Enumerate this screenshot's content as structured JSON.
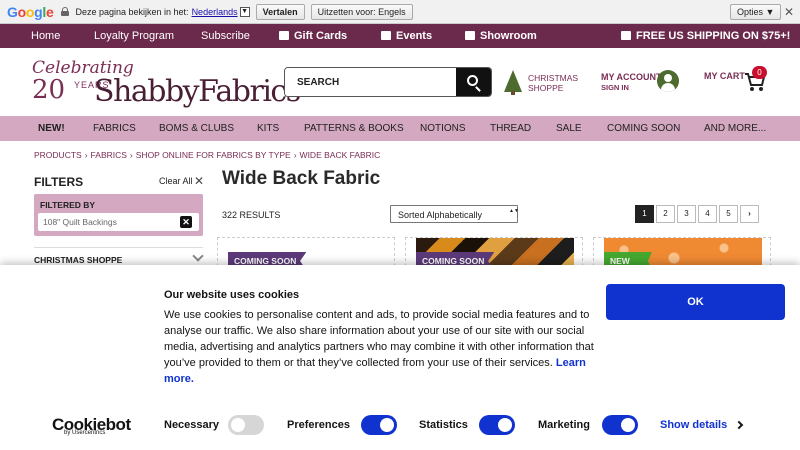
{
  "translate_bar": {
    "logo": "Google",
    "prompt": "Deze pagina bekijken in het:",
    "language": "Nederlands",
    "translate_btn": "Vertalen",
    "disable_btn": "Uitzetten voor: Engels",
    "options_btn": "Opties ▼",
    "close": "✕"
  },
  "top_nav": {
    "home": "Home",
    "loyalty": "Loyalty Program",
    "subscribe": "Subscribe",
    "gift_cards": "Gift Cards",
    "events": "Events",
    "showroom": "Showroom",
    "shipping": "FREE US SHIPPING ON $75+!"
  },
  "header": {
    "logo_celebrating": "Celebrating",
    "logo_20": "20",
    "logo_years": "YEARS",
    "logo_brand": "ShabbyFabrics",
    "search_placeholder": "SEARCH",
    "christmas": "CHRISTMAS SHOPPE",
    "account_title": "MY ACCOUNT",
    "account_sub": "SIGN IN",
    "cart_title": "MY CART",
    "cart_count": "0"
  },
  "category_nav": [
    "NEW!",
    "FABRICS",
    "BOMS & CLUBS",
    "KITS",
    "PATTERNS & BOOKS",
    "NOTIONS",
    "THREAD",
    "SALE",
    "COMING SOON",
    "AND MORE..."
  ],
  "breadcrumbs": [
    "PRODUCTS",
    "FABRICS",
    "SHOP ONLINE FOR FABRICS BY TYPE",
    "WIDE BACK FABRIC"
  ],
  "breadcrumb_sep": "›",
  "filters": {
    "title": "FILTERS",
    "clear_all": "Clear All",
    "clear_x": "✕",
    "filtered_by": "FILTERED BY",
    "chip": "108\" Quilt Backings",
    "chip_x": "✕",
    "section": "CHRISTMAS SHOPPE"
  },
  "main": {
    "title": "Wide Back Fabric",
    "results": "322 RESULTS",
    "sort": "Sorted Alphabetically",
    "sort_arrows": "▲▼",
    "pages": [
      "1",
      "2",
      "3",
      "4",
      "5"
    ],
    "next": "›",
    "cards": [
      {
        "ribbon": "COMING SOON"
      },
      {
        "ribbon": "COMING SOON"
      },
      {
        "ribbon": "NEW"
      }
    ]
  },
  "cookie": {
    "title": "Our website uses cookies",
    "body": "We use cookies to personalise content and ads, to provide social media features and to analyse our traffic. We also share information about your use of our site with our social media, advertising and analytics partners who may combine it with other information that you’ve provided to them or that they’ve collected from your use of their services.",
    "learn_more": "Learn more.",
    "ok": "OK",
    "logo": "Cookiebot",
    "logo_sub": "by Usercentrics",
    "toggles": [
      {
        "label": "Necessary",
        "on": false
      },
      {
        "label": "Preferences",
        "on": true
      },
      {
        "label": "Statistics",
        "on": true
      },
      {
        "label": "Marketing",
        "on": true
      }
    ],
    "show_details": "Show details"
  },
  "colors": {
    "brand_purple": "#6b2a4c",
    "nav_pink": "#d3a8c0",
    "cookie_blue": "#1032cf",
    "ribbon_purple": "#5c3a7a",
    "ribbon_green": "#46a82f"
  }
}
